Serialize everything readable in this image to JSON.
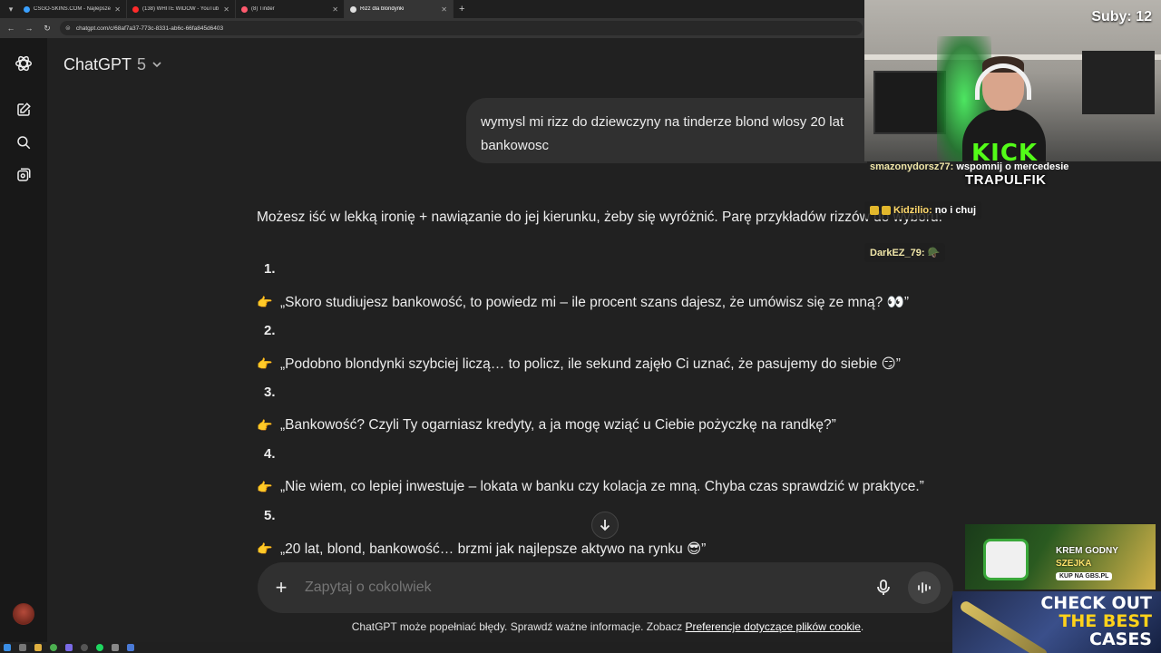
{
  "browser": {
    "tabs": [
      {
        "title": "CSGO-SKINS.COM - Najlepsze",
        "favicon_color": "#3aa0ff",
        "active": false
      },
      {
        "title": "(138) WHITE WIDOW - YouTub",
        "favicon_color": "#ff2b2b",
        "active": false
      },
      {
        "title": "(8) Tinder",
        "favicon_color": "#ff5a6e",
        "active": false
      },
      {
        "title": "Rizz dla blondynki",
        "favicon_color": "#e0e0e0",
        "active": true
      }
    ],
    "url": "chatgpt.com/c/68af7a37-773c-8331-ab6c-66fa845d6403"
  },
  "header": {
    "model_name": "ChatGPT",
    "model_version": "5"
  },
  "conversation": {
    "user_message": "wymysl mi rizz do dziewczyny na tinderze blond wlosy 20 lat bankowosc",
    "intro": "Możesz iść w lekką ironię + nawiązanie do jej kierunku, żeby się wyróżnić. Parę przykładów rizzów do wyboru:",
    "items": [
      {
        "number": "1.",
        "text": "„Skoro studiujesz bankowość, to powiedz mi – ile procent szans dajesz, że umówisz się ze mną? 👀”"
      },
      {
        "number": "2.",
        "text": "„Podobno blondynki szybciej liczą… to policz, ile sekund zajęło Ci uznać, że pasujemy do siebie 😏”"
      },
      {
        "number": "3.",
        "text": "„Bankowość? Czyli Ty ogarniasz kredyty, a ja mogę wziąć u Ciebie pożyczkę na randkę?”"
      },
      {
        "number": "4.",
        "text": "„Nie wiem, co lepiej inwestuje – lokata w banku czy kolacja ze mną. Chyba czas sprawdzić w praktyce.”"
      },
      {
        "number": "5.",
        "text": "„20 lat, blond, bankowość… brzmi jak najlepsze aktywo na rynku 😎”"
      }
    ],
    "bullet_emoji": "👉"
  },
  "composer": {
    "placeholder": "Zapytaj o cokolwiek"
  },
  "disclaimer": {
    "text": "ChatGPT może popełniać błędy. Sprawdź ważne informacje. Zobacz ",
    "link": "Preferencje dotyczące plików cookie",
    "end": "."
  },
  "stream": {
    "subs": "Suby: 12",
    "kick_logo": "KICK",
    "channel": "TRAPULFIK",
    "chat": [
      {
        "user": "smazonydorsz77:",
        "message": "wspomnij o mercedesie"
      },
      {
        "user": "Kidzilio:",
        "message": "no i chuj"
      },
      {
        "user": "DarkEZ_79:",
        "message": "🪖"
      }
    ]
  },
  "ads": {
    "ad1": {
      "line1": "KREM GODNY",
      "line2": "SZEJKA",
      "button": "KUP NA GBS.PL"
    },
    "ad2": {
      "line1": "CHECK OUT",
      "line2": "THE BEST",
      "line3": "CASES"
    }
  }
}
